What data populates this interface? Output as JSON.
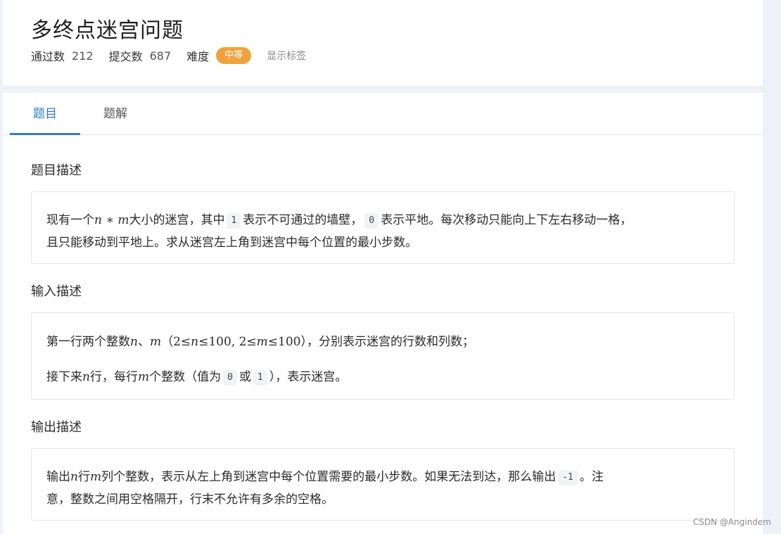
{
  "problem": {
    "title": "多终点迷宫问题",
    "pass_label": "通过数",
    "pass_count": "212",
    "submit_label": "提交数",
    "submit_count": "687",
    "difficulty_label": "难度",
    "difficulty": "中等",
    "show_tags": "显示标签"
  },
  "tabs": [
    {
      "label": "题目",
      "active": true
    },
    {
      "label": "题解",
      "active": false
    }
  ],
  "sections": {
    "desc": {
      "title": "题目描述",
      "l1": {
        "a": "现有一个",
        "n": "n",
        "star": " ∗ ",
        "m": "m",
        "b": "大小的迷宫，其中",
        "code1": "1",
        "c": "表示不可通过的墙壁，",
        "code0": "0",
        "d": "表示平地。每次移动只能向上下左右移动一格，"
      },
      "l2": "且只能移动到平地上。求从迷宫左上角到迷宫中每个位置的最小步数。"
    },
    "input": {
      "title": "输入描述",
      "l1": {
        "a": "第一行两个整数",
        "n": "n",
        "sep": "、",
        "m": "m",
        "paren_open": "（",
        "c1": "2≤",
        "n2": "n",
        "c2": "≤100, 2≤",
        "m2": "m",
        "c3": "≤100",
        "paren_close": "）",
        "b": "，分别表示迷宫的行数和列数；"
      },
      "l2": {
        "a": "接下来",
        "n": "n",
        "b": "行，每行",
        "m": "m",
        "c": "个整数（值为",
        "code0": "0",
        "or": "或",
        "code1": "1",
        "d": "），表示迷宫。"
      }
    },
    "output": {
      "title": "输出描述",
      "l1": {
        "a": "输出",
        "n": "n",
        "b": "行",
        "m": "m",
        "c": "列个整数，表示从左上角到迷宫中每个位置需要的最小步数。如果无法到达，那么输出",
        "code": "-1",
        "d": "。注"
      },
      "l2": "意，整数之间用空格隔开，行末不允许有多余的空格。"
    }
  },
  "watermark": "CSDN @Angindem",
  "colors": {
    "accent": "#2f7cd0",
    "badge": "#f0a23c",
    "page_bg": "#eef1f7"
  }
}
